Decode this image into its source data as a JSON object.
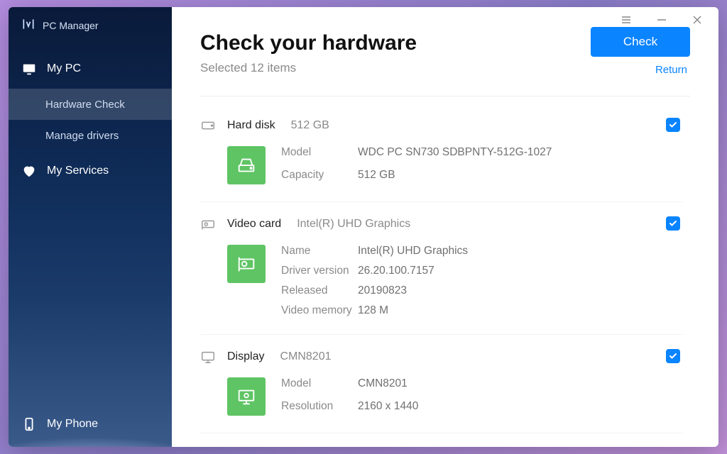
{
  "app": {
    "name": "PC Manager"
  },
  "sidebar": {
    "groups": [
      {
        "label": "My PC",
        "icon": "monitor"
      },
      {
        "label": "My Services",
        "icon": "heart"
      }
    ],
    "sub": [
      {
        "label": "Hardware Check",
        "active": true
      },
      {
        "label": "Manage drivers",
        "active": false
      }
    ],
    "bottom": {
      "label": "My Phone",
      "icon": "phone"
    }
  },
  "header": {
    "title": "Check your hardware",
    "subtitle": "Selected 12 items",
    "check_btn": "Check",
    "return_link": "Return"
  },
  "hardware": [
    {
      "id": "hard-disk",
      "icon": "hdd",
      "title": "Hard disk",
      "summary": "512 GB",
      "checked": true,
      "rows": [
        {
          "k": "Model",
          "v": "WDC PC SN730 SDBPNTY-512G-1027"
        },
        {
          "k": "Capacity",
          "v": "512 GB"
        }
      ]
    },
    {
      "id": "video-card",
      "icon": "gpu",
      "title": "Video card",
      "summary": "Intel(R) UHD Graphics",
      "checked": true,
      "rows": [
        {
          "k": "Name",
          "v": "Intel(R) UHD Graphics"
        },
        {
          "k": "Driver version",
          "v": "26.20.100.7157"
        },
        {
          "k": "Released",
          "v": "20190823"
        },
        {
          "k": "Video memory",
          "v": "128 M"
        }
      ]
    },
    {
      "id": "display",
      "icon": "display",
      "title": "Display",
      "summary": "CMN8201",
      "checked": true,
      "rows": [
        {
          "k": "Model",
          "v": "CMN8201"
        },
        {
          "k": "Resolution",
          "v": "2160 x 1440"
        }
      ]
    }
  ]
}
